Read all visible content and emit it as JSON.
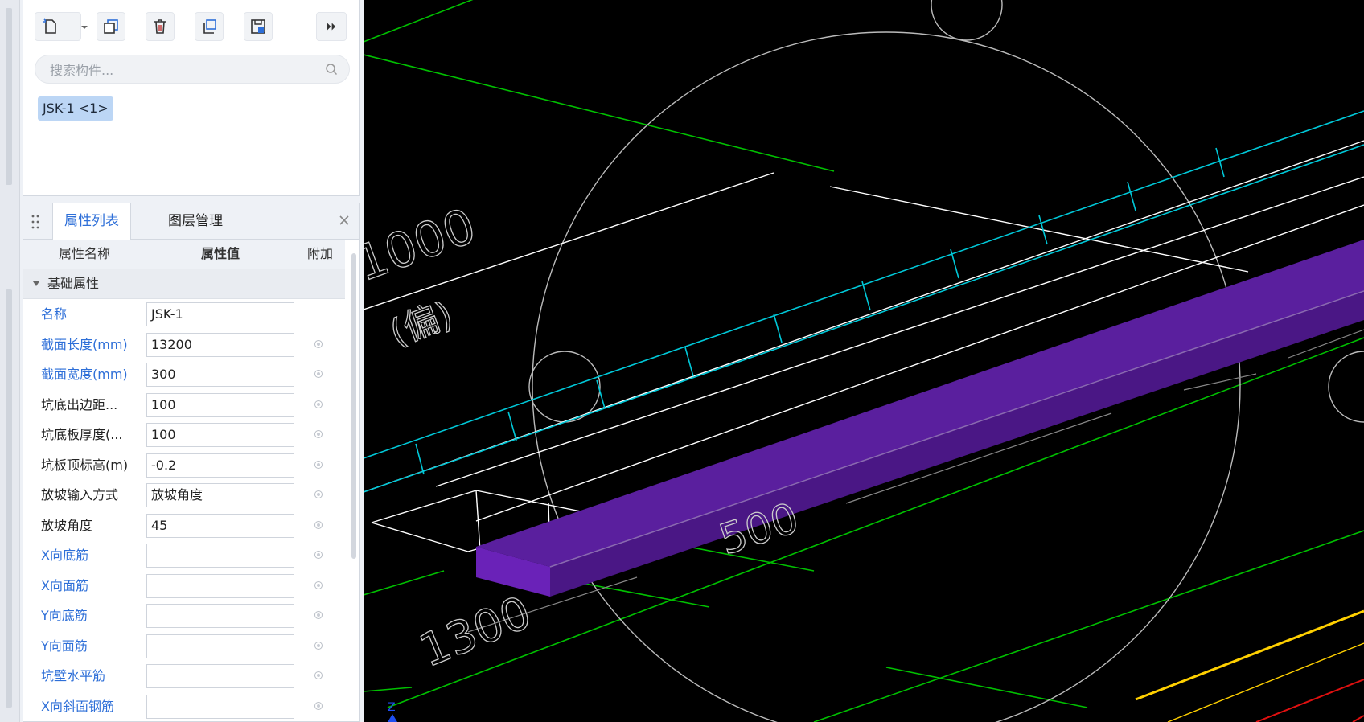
{
  "toolbar": {
    "buttons": [
      "new-component-icon",
      "copy-icon",
      "delete-icon",
      "duplicate-icon",
      "save-icon",
      "more-icon"
    ]
  },
  "search": {
    "placeholder": "搜索构件..."
  },
  "component_list": {
    "items": [
      "JSK-1 <1>"
    ]
  },
  "tabs": {
    "active": "属性列表",
    "inactive": "图层管理"
  },
  "table": {
    "headers": {
      "name": "属性名称",
      "value": "属性值",
      "extra": "附加"
    },
    "group": "基础属性",
    "rows": [
      {
        "name": "名称",
        "value": "JSK-1",
        "color": "blue",
        "dot": false
      },
      {
        "name": "截面长度(mm)",
        "value": "13200",
        "color": "blue",
        "dot": true
      },
      {
        "name": "截面宽度(mm)",
        "value": "300",
        "color": "blue",
        "dot": true
      },
      {
        "name": "坑底出边距...",
        "value": "100",
        "color": "dark",
        "dot": true
      },
      {
        "name": "坑底板厚度(...",
        "value": "100",
        "color": "dark",
        "dot": true
      },
      {
        "name": "坑板顶标高(m)",
        "value": "-0.2",
        "color": "dark",
        "dot": true
      },
      {
        "name": "放坡输入方式",
        "value": "放坡角度",
        "color": "dark",
        "dot": true
      },
      {
        "name": "放坡角度",
        "value": "45",
        "color": "dark",
        "dot": true
      },
      {
        "name": "X向底筋",
        "value": "",
        "color": "blue",
        "dot": true
      },
      {
        "name": "X向面筋",
        "value": "",
        "color": "blue",
        "dot": true
      },
      {
        "name": "Y向底筋",
        "value": "",
        "color": "blue",
        "dot": true
      },
      {
        "name": "Y向面筋",
        "value": "",
        "color": "blue",
        "dot": true
      },
      {
        "name": "坑壁水平筋",
        "value": "",
        "color": "blue",
        "dot": true
      },
      {
        "name": "X向斜面钢筋",
        "value": "",
        "color": "blue",
        "dot": true
      }
    ]
  },
  "viewport": {
    "dimension_labels": [
      "1000",
      "500",
      "1300",
      "(偏)"
    ],
    "colors": {
      "background": "#000000",
      "axis": "#00c000",
      "rebar": "#00c8d8",
      "beam": "#5a1f9e",
      "outline": "#ffffff",
      "highlight": "#ffd000"
    }
  }
}
